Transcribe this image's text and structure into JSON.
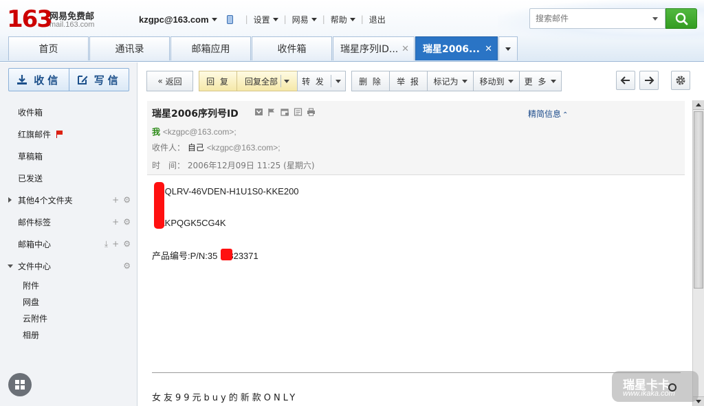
{
  "header": {
    "logo_number": "163",
    "logo_cn": "网易免费邮",
    "logo_url": "mail.163.com",
    "account": "kzgpc@163.com",
    "links": [
      "设置",
      "网易",
      "帮助",
      "退出"
    ],
    "search_placeholder": "搜索邮件"
  },
  "tabs": [
    {
      "label": "首页"
    },
    {
      "label": "通讯录"
    },
    {
      "label": "邮箱应用"
    },
    {
      "label": "收件箱"
    },
    {
      "label": "瑞星序列ID..."
    },
    {
      "label": "瑞星2006..."
    }
  ],
  "sidebar": {
    "receive": "收信",
    "compose": "写信",
    "folders": [
      "收件箱",
      "红旗邮件",
      "草稿箱",
      "已发送",
      "其他4个文件夹",
      "邮件标签",
      "邮箱中心",
      "文件中心"
    ],
    "files": [
      "附件",
      "网盘",
      "云附件",
      "相册"
    ]
  },
  "toolbar": {
    "back": "返回",
    "reply": "回 复",
    "reply_all": "回复全部",
    "forward": "转 发",
    "delete": "删 除",
    "report": "举 报",
    "mark": "标记为",
    "move": "移动到",
    "more": "更 多"
  },
  "mail": {
    "subject": "瑞星2006序列号ID",
    "detail_link": "精简信息",
    "from_name": "我",
    "from_addr": "<kzgpc@163.com>;",
    "to_label": "收件人：",
    "to_name": "自己",
    "to_addr": "<kzgpc@163.com>;",
    "time_label": "时　间：",
    "time_value": "2006年12月09日 11:25 (星期六)",
    "body": [
      "SQLRV-46VDEN-H1U1S0-KKE200",
      "AKPQGK5CG4K",
      "产品编号:P/N:35",
      "823371"
    ],
    "footer_ad": "女友99元buy的新款ONLY"
  },
  "watermark": {
    "line1": "瑞星卡卡",
    "line2": "www.ikaka.com"
  },
  "colors": {
    "brand_red": "#cc0000",
    "active_tab": "#2a74c5",
    "search_green": "#3aa528",
    "redaction": "#ff1010"
  }
}
